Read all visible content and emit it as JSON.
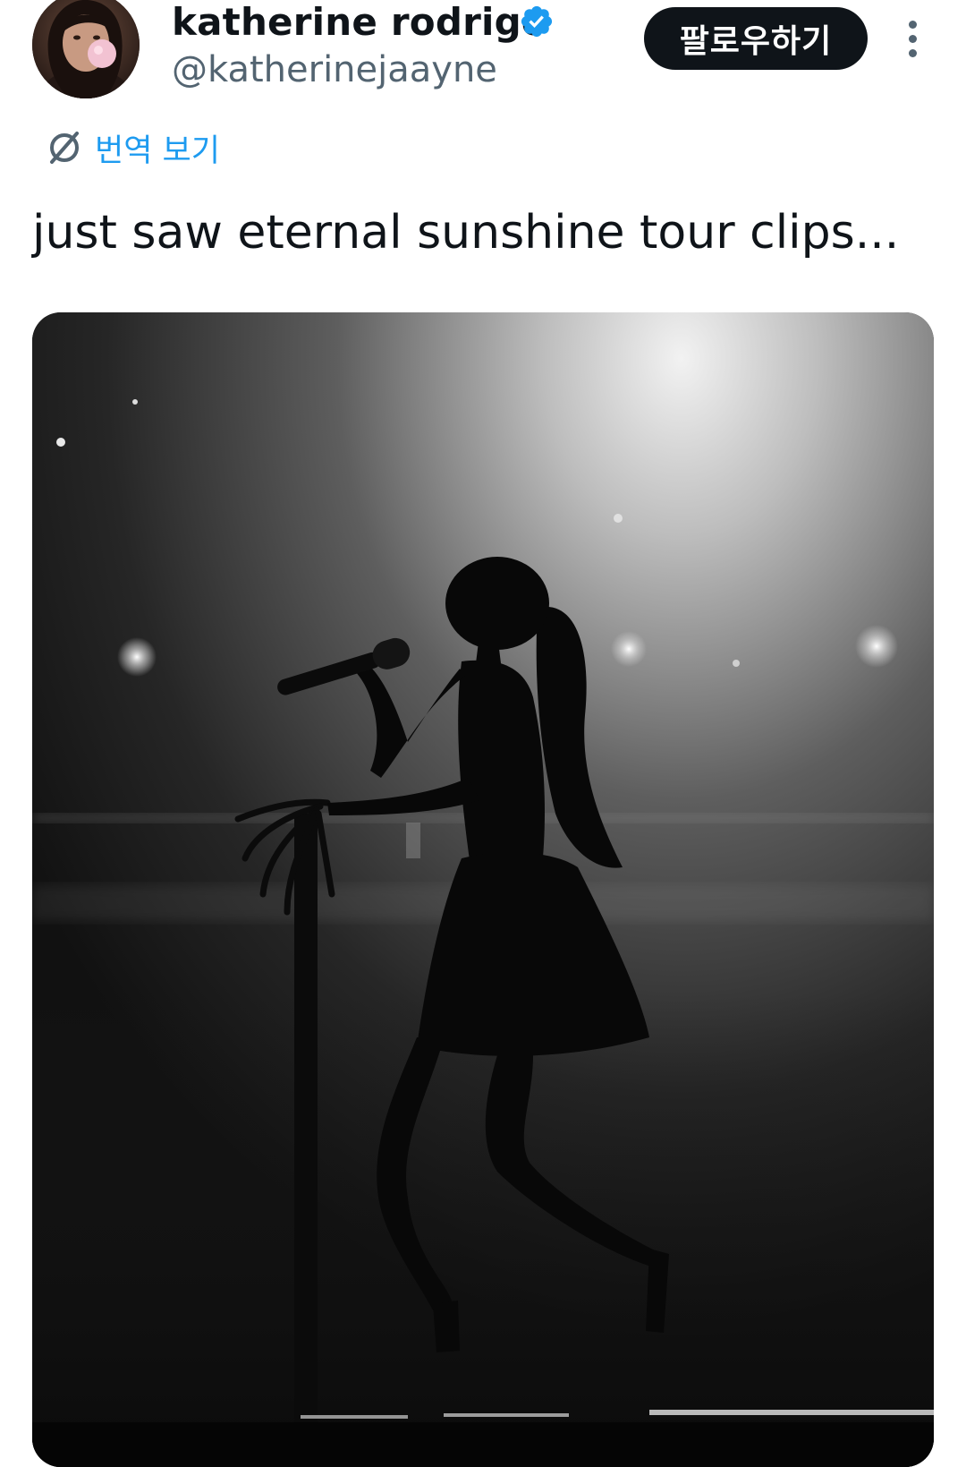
{
  "author": {
    "display_name": "katherine rodrigo",
    "handle": "@katherinejaayne",
    "verified": true,
    "avatar_icon": "profile-photo"
  },
  "actions": {
    "follow_label": "팔로우하기",
    "more_icon": "more-vertical-icon"
  },
  "translate": {
    "label": "번역 보기",
    "icon": "globe-icon"
  },
  "tweet": {
    "text": "just saw eternal sunshine tour clips..."
  },
  "colors": {
    "accent": "#1d9bf0",
    "follow_bg": "#0f1419",
    "text_primary": "#0f1419",
    "text_secondary": "#536471"
  }
}
